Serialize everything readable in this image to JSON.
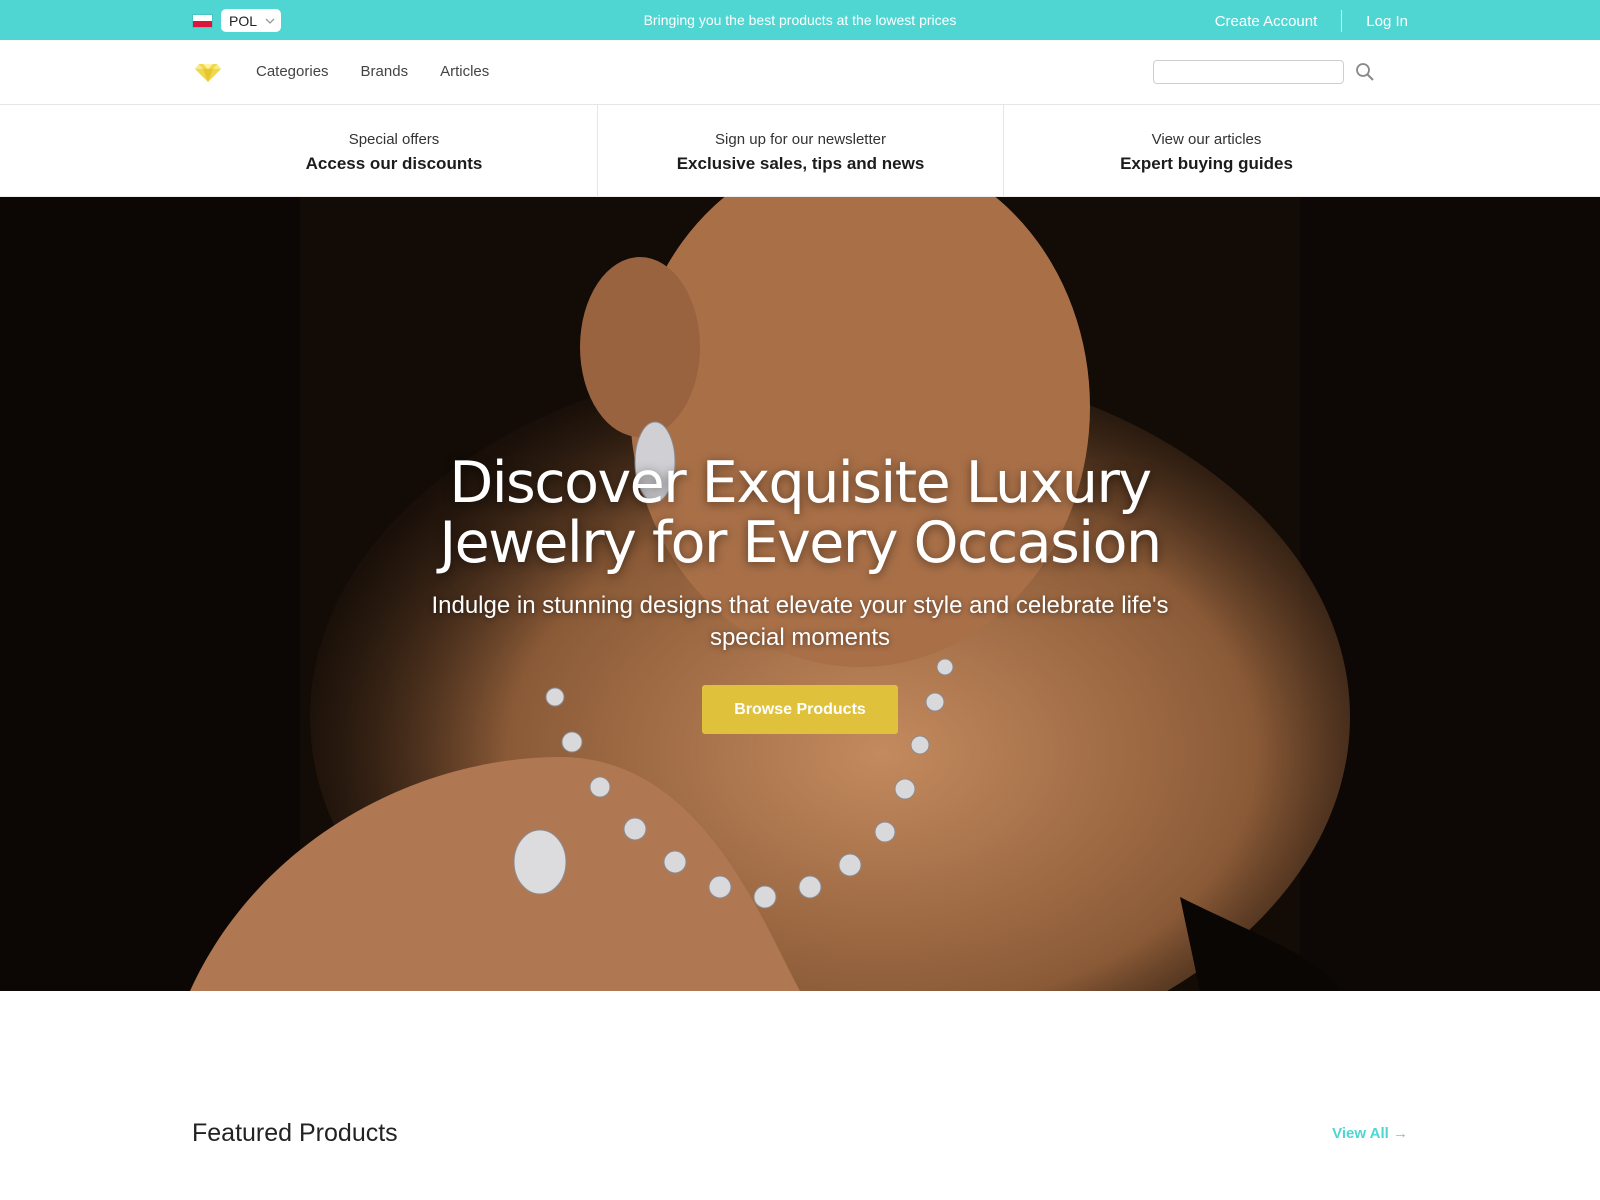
{
  "topbar": {
    "country_code": "POL",
    "tagline": "Bringing you the best products at the lowest prices",
    "create_account": "Create Account",
    "log_in": "Log In",
    "bg_color": "#4fd6d2"
  },
  "nav": {
    "items": [
      "Categories",
      "Brands",
      "Articles"
    ],
    "search_placeholder": ""
  },
  "promos": [
    {
      "sub": "Special offers",
      "head": "Access our discounts"
    },
    {
      "sub": "Sign up for our newsletter",
      "head": "Exclusive sales, tips and news"
    },
    {
      "sub": "View our articles",
      "head": "Expert buying guides"
    }
  ],
  "hero": {
    "title_line1": "Discover Exquisite Luxury",
    "title_line2": "Jewelry for Every Occasion",
    "subtitle": "Indulge in stunning designs that elevate your style and celebrate life's special moments",
    "button": "Browse Products",
    "button_color": "#e0c13c"
  },
  "featured": {
    "title": "Featured Products",
    "view_all": "View All →",
    "link_color": "#4fd6d2"
  }
}
